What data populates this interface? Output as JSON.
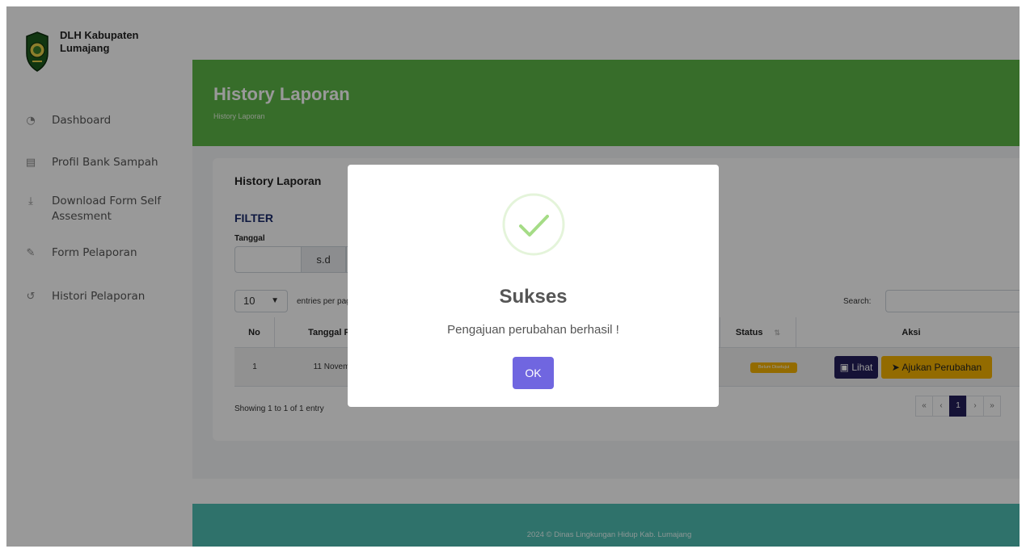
{
  "sidebar": {
    "brand": "DLH Kabupaten Lumajang",
    "items": [
      {
        "label": "Dashboard",
        "icon": "dashboard-icon"
      },
      {
        "label": "Profil Bank Sampah",
        "icon": "building-icon"
      },
      {
        "label": "Download Form Self Assesment",
        "icon": "download-icon"
      },
      {
        "label": "Form Pelaporan",
        "icon": "edit-icon"
      },
      {
        "label": "Histori Pelaporan",
        "icon": "history-icon"
      }
    ]
  },
  "header": {
    "title": "History Laporan",
    "breadcrumb": "History Laporan"
  },
  "card": {
    "title": "History Laporan",
    "filter_title": "FILTER",
    "date_label": "Tanggal",
    "date_separator": "s.d"
  },
  "table_controls": {
    "length_value": "10",
    "length_text": "entries per pag",
    "search_label": "Search:"
  },
  "table": {
    "headers": {
      "no": "No",
      "tanggal": "Tanggal Pe",
      "status": "Status",
      "aksi": "Aksi"
    },
    "row": {
      "no": "1",
      "tanggal": "11 Novem",
      "status": "Belum Disetujui",
      "lihat": "Lihat",
      "ajukan": "Ajukan Perubahan"
    }
  },
  "footer_table": {
    "showing": "Showing 1 to 1 of 1 entry",
    "pages": [
      "«",
      "‹",
      "1",
      "›",
      "»"
    ]
  },
  "footer": {
    "text": "2024 © Dinas Lingkungan Hidup Kab. Lumajang"
  },
  "modal": {
    "title": "Sukses",
    "message": "Pengajuan perubahan berhasil !",
    "ok_label": "OK",
    "icon": "success-check-icon"
  },
  "colors": {
    "hero": "#5cb646",
    "footer": "#4fbfb2",
    "primary_dark": "#241e5a",
    "warning": "#f5b301",
    "modal_button": "#7066e0",
    "success_check": "#a5dc86"
  }
}
